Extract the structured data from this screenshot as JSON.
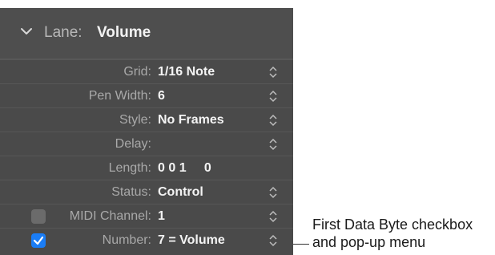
{
  "lane": {
    "key": "Lane:",
    "value": "Volume"
  },
  "rows": [
    {
      "label": "Grid:",
      "value": "1/16 Note",
      "stepper": true
    },
    {
      "label": "Pen Width:",
      "value": "6",
      "stepper": true
    },
    {
      "label": "Style:",
      "value": "No Frames",
      "stepper": true
    },
    {
      "label": "Delay:",
      "value": "",
      "stepper": true
    },
    {
      "label": "Length:",
      "value": "0 0 1     0",
      "stepper": false
    },
    {
      "label": "Status:",
      "value": "Control",
      "stepper": true
    },
    {
      "label": "MIDI Channel:",
      "value": "1",
      "stepper": true,
      "checkbox": false
    },
    {
      "label": "Number:",
      "value": "7 = Volume",
      "stepper": true,
      "checkbox": true
    }
  ],
  "callout": {
    "line1": "First Data Byte checkbox",
    "line2": "and pop-up menu"
  },
  "icons": {
    "collapse": "chevron-down-icon",
    "stepper": "up-down-stepper-icon",
    "check": "checkmark-icon"
  },
  "colors": {
    "panel": "#4a4a4a",
    "checkbox_on": "#1a7df6"
  }
}
